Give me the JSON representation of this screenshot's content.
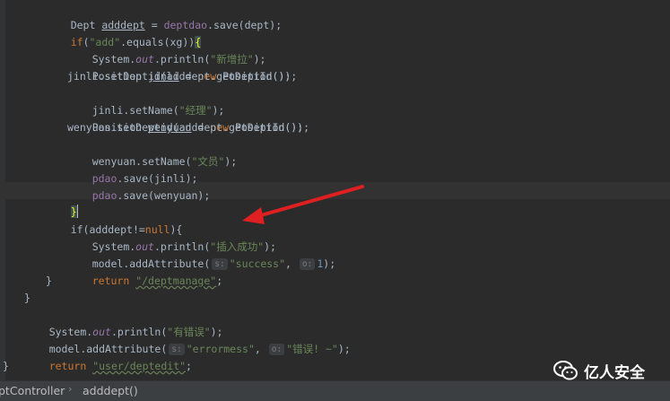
{
  "code": {
    "l1": {
      "a": "Dept ",
      "b": "adddept",
      "c": " = ",
      "d": "deptdao",
      "e": ".save(dept);"
    },
    "l2": {
      "a": "if",
      "b": "(",
      "c": "\"add\"",
      "d": ".equals(xg))",
      "e": "{"
    },
    "l3": {
      "a": "System.",
      "b": "out",
      "c": ".println(",
      "d": "\"新增拉\"",
      "e": ");"
    },
    "l4": {
      "a": "Position ",
      "b": "jinli",
      "c": " = ",
      "d": "new",
      "e": " Position();"
    },
    "l5": "jinli.setDeptid(adddept.getDeptId());",
    "l6": {
      "a": "jinli.setName(",
      "b": "\"经理\"",
      "c": ");"
    },
    "l7": {
      "a": "Position ",
      "b": "wenyuan",
      "c": " = ",
      "d": "new",
      "e": " Position();"
    },
    "l8": "wenyuan.setDeptid(adddept.getDeptId());",
    "l9": {
      "a": "wenyuan.setName(",
      "b": "\"文员\"",
      "c": ");"
    },
    "l10": {
      "a": "pdao",
      "b": ".save(jinli);"
    },
    "l11": {
      "a": "pdao",
      "b": ".save(wenyuan);"
    },
    "l12": "}",
    "l13": {
      "a": "if(adddept!=",
      "b": "null",
      "c": "){"
    },
    "l14": {
      "a": "System.",
      "b": "out",
      "c": ".println(",
      "d": "\"插入成功\"",
      "e": ");"
    },
    "l15": {
      "a": "model.addAttribute(",
      "b": "s:",
      "c": "\"success\"",
      "d": ", ",
      "e": "o:",
      "f": "1",
      "g": ");"
    },
    "l16": {
      "a": "return",
      "b": " ",
      "c": "\"/deptmanage\"",
      "d": ";"
    },
    "l17": "}",
    "l18": "}",
    "l19": {
      "a": "System.",
      "b": "out",
      "c": ".println(",
      "d": "\"有错误\"",
      "e": ");"
    },
    "l20": {
      "a": "model.addAttribute(",
      "b": "s:",
      "c": "\"errormess\"",
      "d": ", ",
      "e": "o:",
      "f": "\"错误! ~\"",
      "g": ");"
    },
    "l21": {
      "a": "return",
      "b": " ",
      "c": "\"user/deptedit\"",
      "d": ";"
    },
    "l22": "}"
  },
  "breadcrumb": {
    "class": "ptController",
    "method": "adddept()"
  },
  "watermark": {
    "text": "亿人安全",
    "icon": "wechat-icon"
  },
  "colors": {
    "background": "#2b2b2b",
    "keyword": "#cc7832",
    "string": "#6a8759",
    "field": "#9876aa",
    "number": "#6897bb",
    "text": "#a9b7c6",
    "arrow": "#e02020"
  }
}
